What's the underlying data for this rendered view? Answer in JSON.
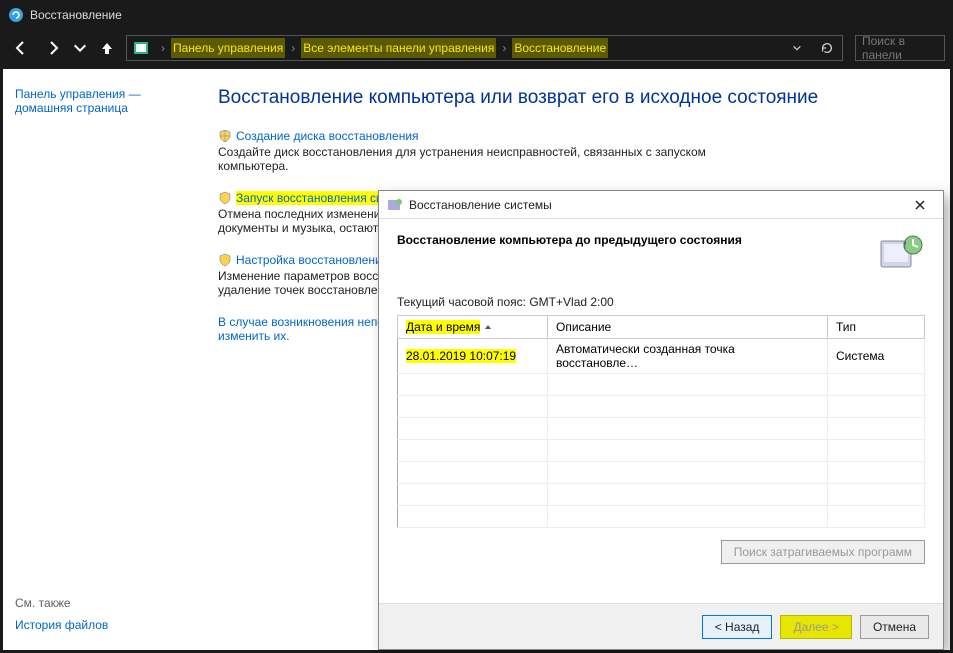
{
  "window": {
    "title": "Восстановление"
  },
  "nav": {
    "breadcrumb": [
      "Панель управления",
      "Все элементы панели управления",
      "Восстановление"
    ],
    "search_placeholder": "Поиск в панели"
  },
  "sidebar": {
    "home_line1": "Панель управления —",
    "home_line2": "домашняя страница",
    "see_also": "См. также",
    "file_history": "История файлов"
  },
  "main": {
    "heading": "Восстановление компьютера или возврат его в исходное состояние",
    "tasks": [
      {
        "title": "Создание диска восстановления",
        "desc": "Создайте диск восстановления для устранения неисправностей, связанных с запуском компьютера.",
        "highlight": false
      },
      {
        "title": "Запуск восстановления системы",
        "desc": "Отмена последних изменений системы. Однако такие файлы, как электронная почта, документы и музыка, остаются без изменений.",
        "highlight": true
      },
      {
        "title": "Настройка восстановления системы",
        "desc": "Изменение параметров восстановления, управление дисковым пространством и создание/удаление точек восстановления.",
        "highlight": false
      }
    ],
    "note_line1": "В случае возникновения неполадок с компьютером перейдите к его параметрам и попробуйте",
    "note_line2": "изменить их."
  },
  "dialog": {
    "title": "Восстановление системы",
    "heading": "Восстановление компьютера до предыдущего состояния",
    "timezone_label": "Текущий часовой пояс: GMT+Vlad 2:00",
    "columns": {
      "date": "Дата и время",
      "desc": "Описание",
      "type": "Тип"
    },
    "rows": [
      {
        "date": "28.01.2019 10:07:19",
        "desc": "Автоматически созданная точка восстановле…",
        "type": "Система"
      }
    ],
    "scan_btn": "Поиск затрагиваемых программ",
    "back": "< Назад",
    "next": "Далее >",
    "cancel": "Отмена"
  }
}
